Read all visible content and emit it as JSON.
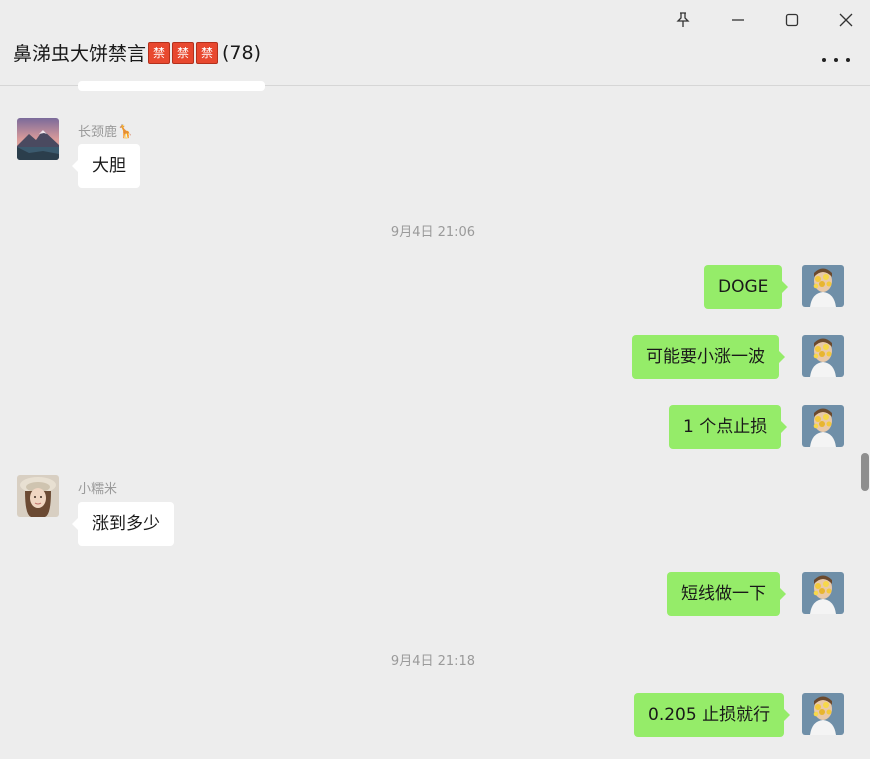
{
  "window": {
    "title": "鼻涕虫大饼禁言",
    "ban_glyph": "禁",
    "member_count": "(78)"
  },
  "messages": [
    {
      "dir": "in",
      "sender": "长颈鹿🦒",
      "text": "大胆",
      "avatar": "mountain-lake-avatar"
    },
    {
      "timestamp": "9月4日 21:06"
    },
    {
      "dir": "out",
      "text": "DOGE",
      "avatar": "flower-face-avatar"
    },
    {
      "dir": "out",
      "text": "可能要小涨一波",
      "avatar": "flower-face-avatar"
    },
    {
      "dir": "out",
      "text": "1 个点止损",
      "avatar": "flower-face-avatar"
    },
    {
      "dir": "in",
      "sender": "小糯米",
      "text": "涨到多少",
      "avatar": "girl-hat-avatar"
    },
    {
      "dir": "out",
      "text": "短线做一下",
      "avatar": "flower-face-avatar"
    },
    {
      "timestamp": "9月4日 21:18"
    },
    {
      "dir": "out",
      "text": "0.205 止损就行",
      "avatar": "flower-face-avatar"
    }
  ],
  "colors": {
    "background": "#ededed",
    "incoming_bubble": "#ffffff",
    "outgoing_bubble": "#95ec69",
    "meta_text": "#9a9a9a"
  }
}
